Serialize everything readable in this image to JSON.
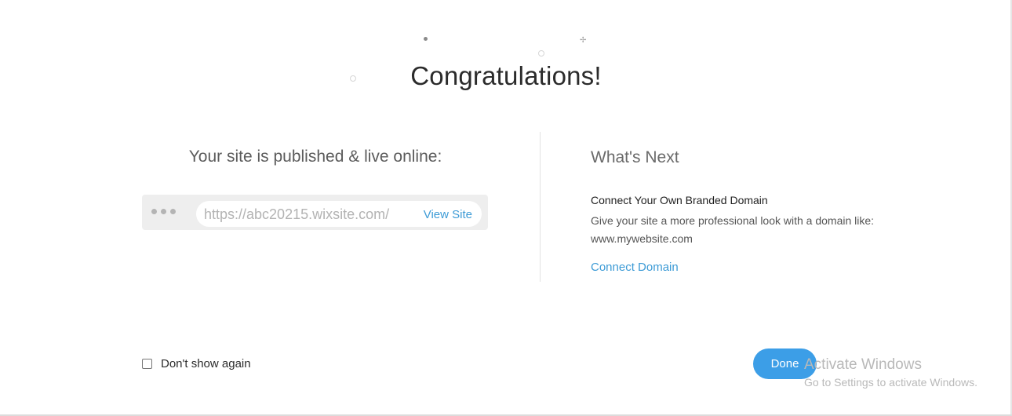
{
  "dialog": {
    "title": "Congratulations!",
    "published_heading": "Your site is published & live online:",
    "site_url": "https://abc20215.wixsite.com/",
    "view_site_label": "View Site",
    "whats_next_heading": "What's Next",
    "domain_title": "Connect Your Own Branded Domain",
    "domain_description": "Give your site a more professional look with a domain like: www.mywebsite.com",
    "connect_domain_label": "Connect Domain",
    "dont_show_label": "Don't show again",
    "done_label": "Done"
  },
  "watermark": {
    "title": "Activate Windows",
    "subtitle": "Go to Settings to activate Windows."
  },
  "colors": {
    "accent": "#3c9ee7",
    "link": "#3d9bd6",
    "text": "#2b2b2b"
  }
}
